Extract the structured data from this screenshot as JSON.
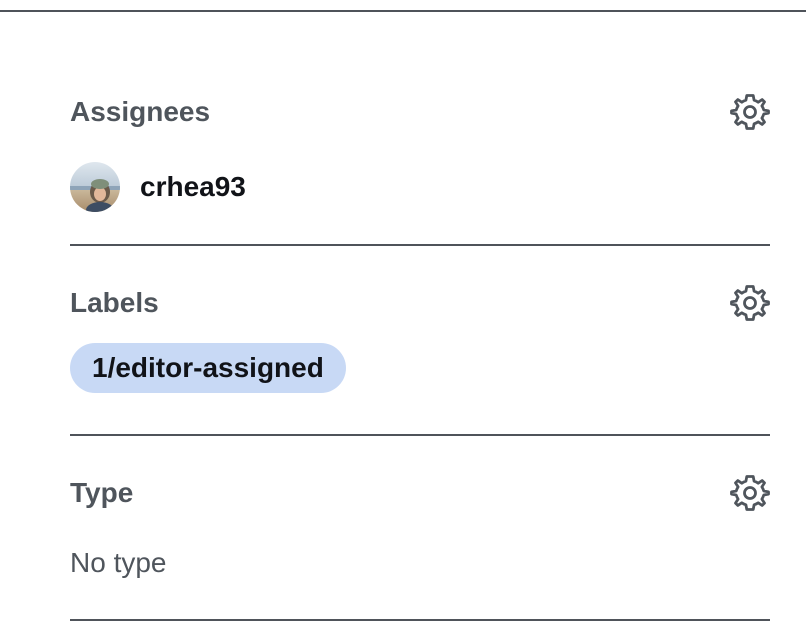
{
  "sidebar": {
    "assignees": {
      "title": "Assignees",
      "settings_icon": "gear-icon",
      "users": [
        {
          "username": "crhea93",
          "avatar_icon": "avatar-photo"
        }
      ]
    },
    "labels": {
      "title": "Labels",
      "settings_icon": "gear-icon",
      "items": [
        {
          "name": "1/editor-assigned",
          "color": "#c8d9f5"
        }
      ]
    },
    "type": {
      "title": "Type",
      "settings_icon": "gear-icon",
      "value": "No type"
    }
  },
  "colors": {
    "heading": "#4f555c",
    "divider": "#4f535a",
    "label_chip": "#c8d9f5"
  }
}
